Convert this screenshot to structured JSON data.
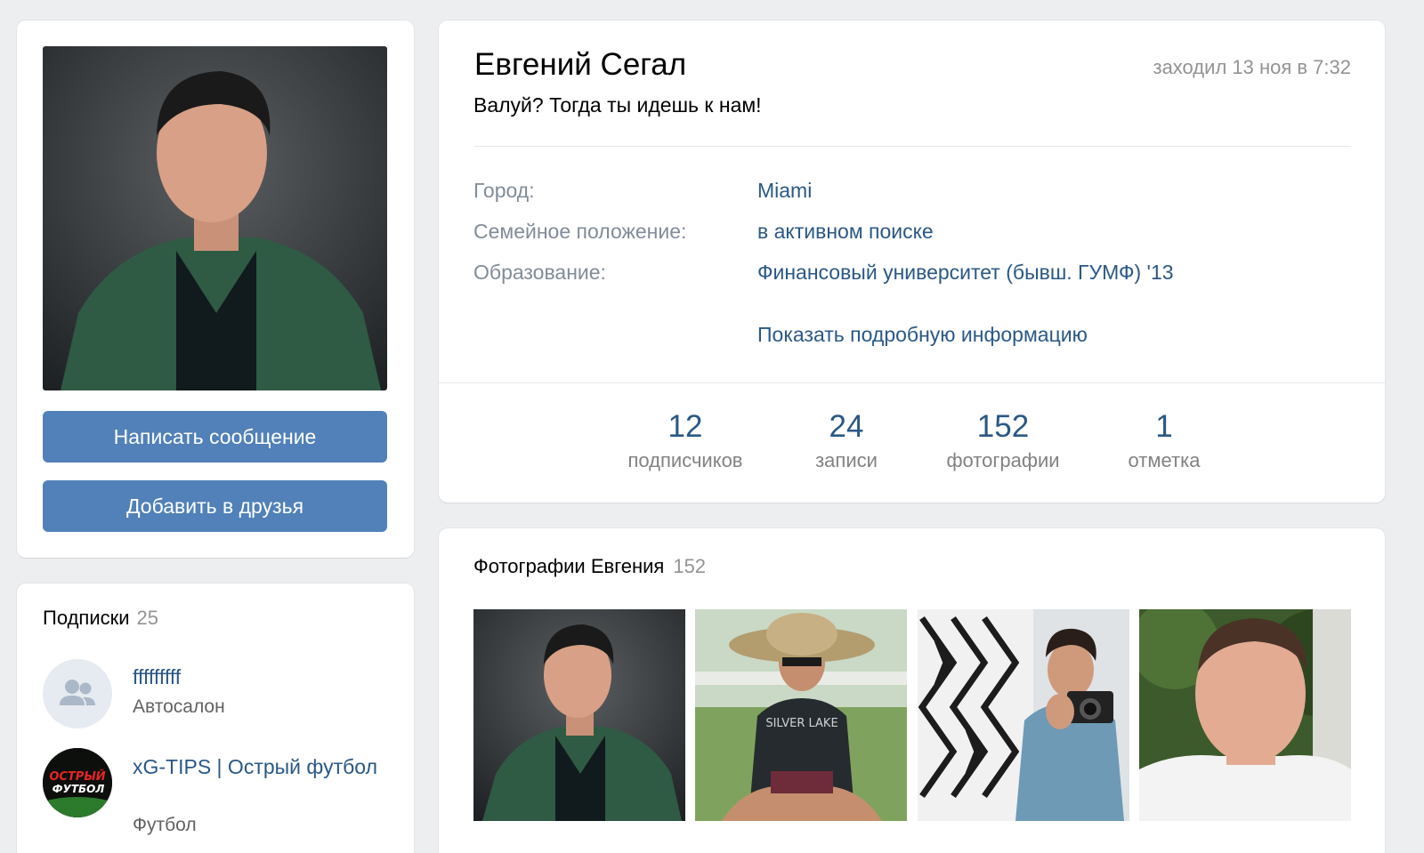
{
  "profile": {
    "name": "Евгений Сегал",
    "status": "Валуй? Тогда ты идешь к нам!",
    "last_seen": "заходил 13 ноя в 7:32",
    "info": [
      {
        "label": "Город:",
        "value": "Miami"
      },
      {
        "label": "Семейное положение:",
        "value": "в активном поиске"
      },
      {
        "label": "Образование:",
        "value": "Финансовый университет (бывш. ГУМФ) '13"
      }
    ],
    "show_more": "Показать подробную информацию",
    "counters": [
      {
        "num": "12",
        "label": "подписчиков"
      },
      {
        "num": "24",
        "label": "записи"
      },
      {
        "num": "152",
        "label": "фотографии"
      },
      {
        "num": "1",
        "label": "отметка"
      }
    ]
  },
  "actions": {
    "message": "Написать сообщение",
    "add_friend": "Добавить в друзья"
  },
  "subscriptions": {
    "title": "Подписки",
    "count": "25",
    "items": [
      {
        "name": "fffffffff",
        "type": "Автосалон",
        "icon": "group-icon"
      },
      {
        "name": "xG-TIPS | Острый футбол",
        "type": "Футбол",
        "logo_text_1": "ОСТРЫЙ",
        "logo_text_2": "ФУТБОЛ"
      }
    ]
  },
  "photos": {
    "title": "Фотографии Евгения",
    "count": "152",
    "graphic_text": "SILVER LAKE"
  },
  "colors": {
    "accent": "#5181b8",
    "link": "#2a5885",
    "muted": "#939393"
  }
}
